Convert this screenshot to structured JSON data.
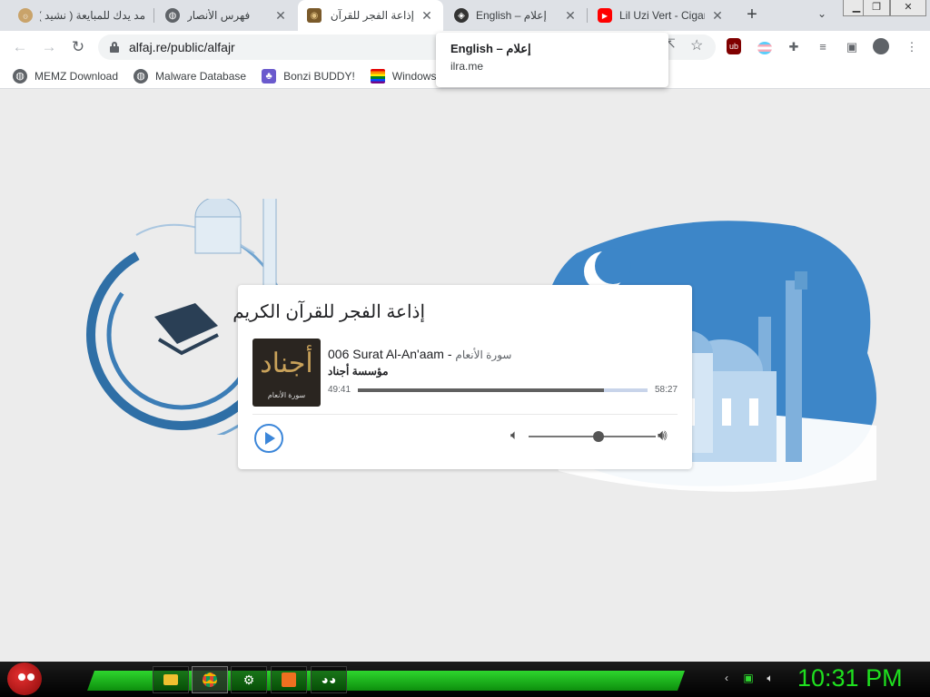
{
  "browser": {
    "tabs": [
      {
        "title": "مد يدك للمبايعة ( نشيد )",
        "icon": "quran-icon",
        "active": false
      },
      {
        "title": "فهرس الأنصار",
        "icon": "globe-icon",
        "active": false
      },
      {
        "title": "إذاعة الفجر للقرآن الكري",
        "icon": "radio-logo-icon",
        "active": true
      },
      {
        "title": "English – إعلام",
        "icon": "ilra-icon",
        "active": false
      },
      {
        "title": "Lil Uzi Vert - Cigar",
        "icon": "youtube-icon",
        "active": false
      }
    ],
    "close_glyph": "✕",
    "new_tab_glyph": "+",
    "url": "alfaj.re/public/alfajr",
    "bookmarks": [
      {
        "label": "MEMZ Download",
        "icon": "globe-icon"
      },
      {
        "label": "Malware Database",
        "icon": "globe-icon"
      },
      {
        "label": "Bonzi BUDDY!",
        "icon": "bonzi-icon"
      },
      {
        "label": "Windows I",
        "icon": "windows-flag-icon"
      }
    ],
    "hovercard": {
      "title": "English – إعلام",
      "url": "ilra.me"
    }
  },
  "player": {
    "title": "إذاعة الفجر للقرآن الكريم",
    "track_en": "006 Surat Al-An'aam -",
    "track_ar": "سورة الأنعام",
    "artist": "مؤسسة أجناد",
    "cover_big": "أجناد",
    "cover_small": "سورة الأنعام",
    "elapsed": "49:41",
    "duration": "58:27",
    "progress_fraction": 0.85,
    "volume_fraction": 0.55,
    "accent_color": "#3b86d9"
  },
  "taskbar": {
    "clock": "10:31 PM",
    "band_color": "#2ed62e"
  }
}
